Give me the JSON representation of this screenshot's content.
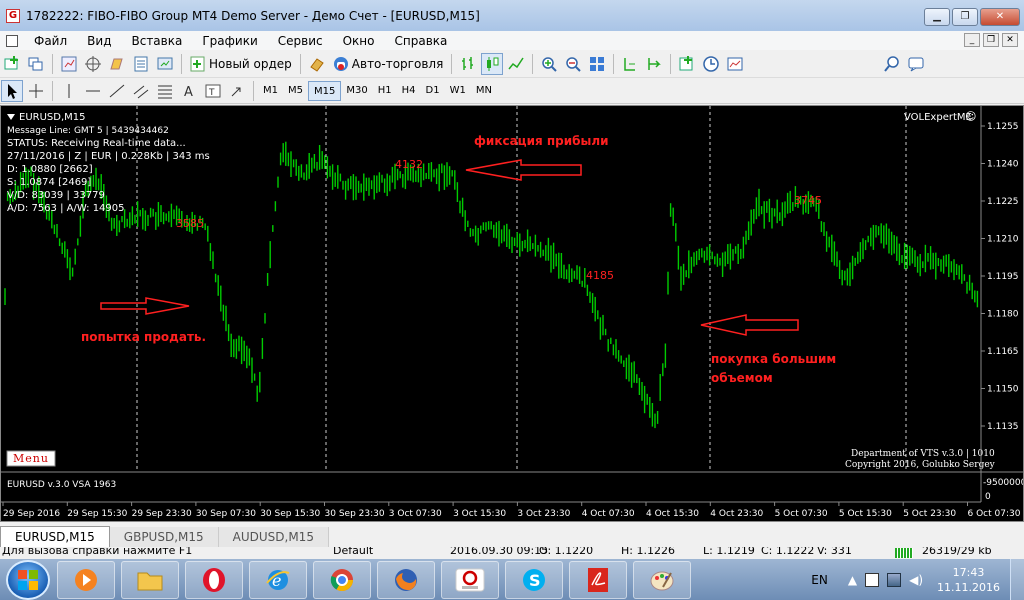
{
  "window": {
    "title": "1782222: FIBO-FIBO Group MT4 Demo Server - Демо Счет - [EURUSD,M15]",
    "app_icon": "G",
    "controls": {
      "minimize": "▁",
      "maximize": "❐",
      "close": "✕"
    }
  },
  "menu": {
    "items": [
      "Файл",
      "Вид",
      "Вставка",
      "Графики",
      "Сервис",
      "Окно",
      "Справка"
    ],
    "mdi_controls": [
      "_",
      "❐",
      "✕"
    ]
  },
  "toolbar": {
    "new_order": "Новый ордер",
    "autotrading": "Авто-торговля",
    "timeframes": [
      "M1",
      "M5",
      "M15",
      "M30",
      "H1",
      "H4",
      "D1",
      "W1",
      "MN"
    ],
    "active_timeframe": "M15"
  },
  "chart": {
    "symbol_header": "EURUSD,M15",
    "expert": "VOLExpertME",
    "info_lines": [
      "Message Line: GMT 5 | 5439434462",
      "STATUS:  Receiving Real-time data...",
      "27/11/2016 | Z | EUR | 0.228Kb | 343 ms",
      "D: 1.0880  [2662]",
      "S: 1.0874  [2469]",
      "V/D: 83039 | 33779",
      "A/D: 7563 | A/W: 14905"
    ],
    "menu_button": "Menu",
    "footer_lines": [
      "Department of VTS  v.3.0 | 1010",
      "Copyright 2016, Golubko Sergey"
    ],
    "price_labels": [
      "1.1255",
      "1.1240",
      "1.1225",
      "1.1210",
      "1.1195",
      "1.1180",
      "1.1165",
      "1.1150",
      "1.1135"
    ],
    "volume_labels": [
      "3585",
      "4132",
      "4185",
      "3745"
    ],
    "annotations": {
      "sell_attempt": "попытка продать.",
      "take_profit": "фиксация прибыли",
      "buy_big_1": "покупка большим",
      "buy_big_2": "объемом"
    },
    "indicator": {
      "label": "EURUSD  v.3.0  VSA  1963",
      "scale_top": "-9500000",
      "scale_bottom": "0"
    },
    "time_labels": [
      "29 Sep 2016",
      "29 Sep 15:30",
      "29 Sep 23:30",
      "30 Sep 07:30",
      "30 Sep 15:30",
      "30 Sep 23:30",
      "3 Oct 07:30",
      "3 Oct 15:30",
      "3 Oct 23:30",
      "4 Oct 07:30",
      "4 Oct 15:30",
      "4 Oct 23:30",
      "5 Oct 07:30",
      "5 Oct 15:30",
      "5 Oct 23:30",
      "6 Oct 07:30"
    ],
    "colors": {
      "candles": "#00cc00",
      "annotation": "#ff2020",
      "background": "#000000",
      "text": "#ffffff"
    }
  },
  "tabs": [
    "EURUSD,M15",
    "GBPUSD,M15",
    "AUDUSD,M15"
  ],
  "status": {
    "help": "Для вызова справки нажмите F1",
    "profile": "Default",
    "datetime": "2016.09.30 09:15",
    "open": "O: 1.1220",
    "high": "H: 1.1226",
    "low": "L: 1.1219",
    "close": "C: 1.1222",
    "volume": "V: 331",
    "traffic": "26319/29 kb"
  },
  "taskbar": {
    "apps": [
      "media-player",
      "file-explorer",
      "opera",
      "internet-explorer",
      "chrome",
      "firefox",
      "fibo-group",
      "skype",
      "acrobat",
      "paint"
    ],
    "language": "EN",
    "time": "17:43",
    "date": "11.11.2016"
  }
}
